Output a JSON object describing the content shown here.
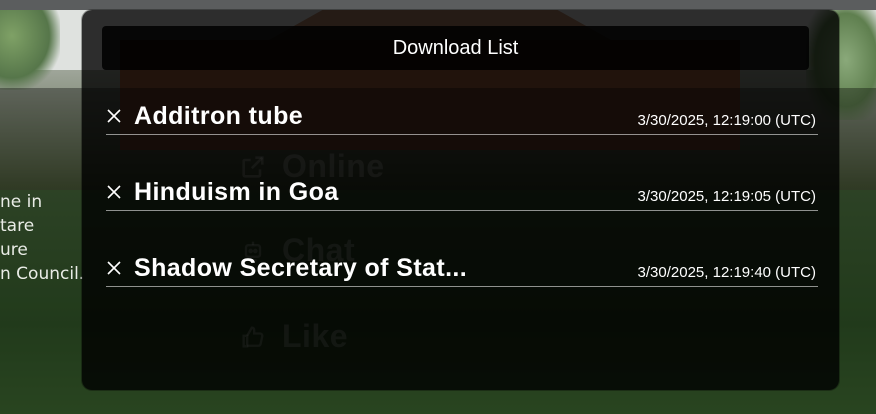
{
  "background": {
    "article_lines": [
      "ne in",
      "tare",
      "ure",
      "n Council."
    ],
    "menu": [
      {
        "label": "Online",
        "icon": "external-link-icon"
      },
      {
        "label": "Chat",
        "icon": "chat-robot-icon"
      },
      {
        "label": "Like",
        "icon": "thumbs-up-icon"
      }
    ]
  },
  "download_list": {
    "title": "Download List",
    "items": [
      {
        "title": "Additron tube",
        "timestamp": "3/30/2025, 12:19:00 (UTC)"
      },
      {
        "title": "Hinduism in Goa",
        "timestamp": "3/30/2025, 12:19:05 (UTC)"
      },
      {
        "title": "Shadow Secretary of Stat...",
        "timestamp": "3/30/2025, 12:19:40 (UTC)"
      }
    ]
  },
  "colors": {
    "overlay_bg": "#000000",
    "text": "#ffffff",
    "menu_text_faded": "#ffffff"
  }
}
